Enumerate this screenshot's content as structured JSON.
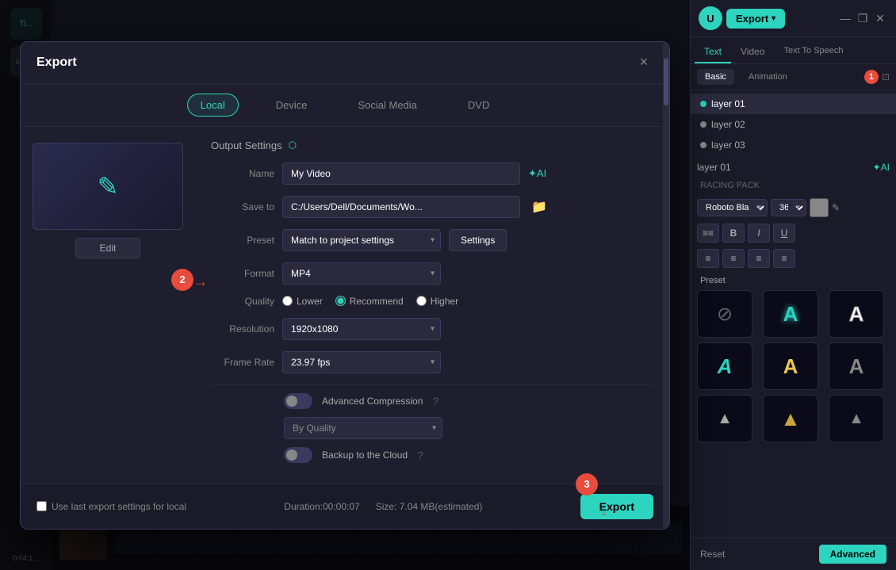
{
  "app": {
    "title": "Export"
  },
  "modal": {
    "title": "Export",
    "close_label": "×",
    "tabs": [
      {
        "id": "local",
        "label": "Local",
        "active": true
      },
      {
        "id": "device",
        "label": "Device",
        "active": false
      },
      {
        "id": "social",
        "label": "Social Media",
        "active": false
      },
      {
        "id": "dvd",
        "label": "DVD",
        "active": false
      }
    ],
    "output_settings": {
      "title": "Output Settings",
      "name_label": "Name",
      "name_value": "My Video",
      "save_to_label": "Save to",
      "save_to_value": "C:/Users/Dell/Documents/Wo...",
      "preset_label": "Preset",
      "preset_value": "Match to project settings",
      "settings_btn": "Settings",
      "format_label": "Format",
      "format_value": "MP4",
      "quality_label": "Quality",
      "quality_options": [
        "Lower",
        "Recommend",
        "Higher"
      ],
      "quality_selected": "Recommend",
      "resolution_label": "Resolution",
      "resolution_value": "1920x1080",
      "frame_rate_label": "Frame Rate",
      "frame_rate_value": "23.97 fps"
    },
    "advanced_compression": {
      "label": "Advanced Compression",
      "enabled": false,
      "help": "?",
      "quality_preset": "By Quality"
    },
    "backup_cloud": {
      "label": "Backup to the Cloud",
      "enabled": false,
      "help": "?"
    },
    "footer": {
      "checkbox_label": "Use last export settings for local",
      "duration_label": "Duration:00:00:07",
      "size_label": "Size: 7.04 MB(estimated)",
      "export_btn": "Export"
    }
  },
  "right_panel": {
    "header": {
      "export_btn": "Export",
      "minimize": "—",
      "maximize": "❐",
      "close": "✕"
    },
    "tabs": [
      "Text",
      "Video",
      "Text To Speech"
    ],
    "active_tab": "Text",
    "subtabs": [
      "Basic",
      "Animation"
    ],
    "active_subtab": "Basic",
    "layer_label": "layer 01",
    "layers": [
      {
        "id": "layer01",
        "label": "layer 01",
        "active": true
      },
      {
        "id": "layer02",
        "label": "layer 02",
        "active": false
      },
      {
        "id": "layer03",
        "label": "layer 03",
        "active": false
      }
    ],
    "racing_pack": "RACING PACK",
    "font_name": "Roboto Bla",
    "font_size": "36",
    "format_buttons": [
      "≡≡",
      "B",
      "I",
      "U"
    ],
    "align_buttons": [
      "≡",
      "≡",
      "≡",
      "≡"
    ],
    "preset_label": "Preset",
    "reset_btn": "Reset",
    "advanced_btn": "Advanced"
  },
  "steps": {
    "step2": "2",
    "step3": "3"
  },
  "icons": {
    "folder": "📁",
    "ai": "✦",
    "settings": "⚙",
    "help": "?",
    "pencil": "✎",
    "chevron": "▾"
  }
}
